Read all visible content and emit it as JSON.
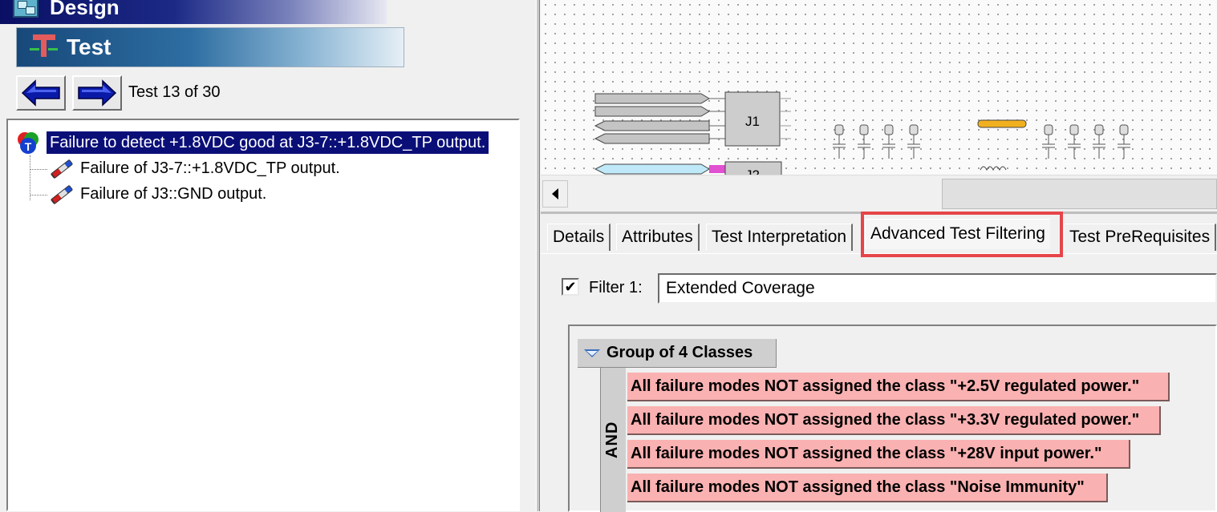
{
  "left_pane": {
    "design_title": "Design",
    "test_title": "Test",
    "nav": {
      "prev_icon": "arrow-left-icon",
      "next_icon": "arrow-right-icon"
    },
    "test_count": "Test 13 of 30",
    "tree": {
      "root_label": "Failure to detect +1.8VDC good at J3-7::+1.8VDC_TP output.",
      "children": [
        {
          "label": "Failure of J3-7::+1.8VDC_TP output."
        },
        {
          "label": "Failure of J3::GND output."
        }
      ]
    }
  },
  "schematic": {
    "components": [
      "J1",
      "J2"
    ]
  },
  "tabs": [
    {
      "label": "Details"
    },
    {
      "label": "Attributes"
    },
    {
      "label": "Test Interpretation"
    },
    {
      "label": "Advanced Test Filtering",
      "active": true
    },
    {
      "label": "Test PreRequisites"
    }
  ],
  "filter": {
    "checked": true,
    "check_mark": "✔",
    "label": "Filter 1:",
    "value": "Extended Coverage"
  },
  "group": {
    "title": "Group of 4 Classes",
    "operator": "AND",
    "classes": [
      "All failure modes NOT assigned the class \"+2.5V regulated power.\"",
      "All failure modes NOT assigned the class \"+3.3V regulated power.\"",
      "All failure modes NOT assigned the class \"+28V input power.\"",
      "All failure modes NOT assigned the class \"Noise Immunity\""
    ]
  },
  "colors": {
    "selection": "#0a0f78",
    "class_row": "#fab1b1",
    "highlight": "#e54549"
  }
}
